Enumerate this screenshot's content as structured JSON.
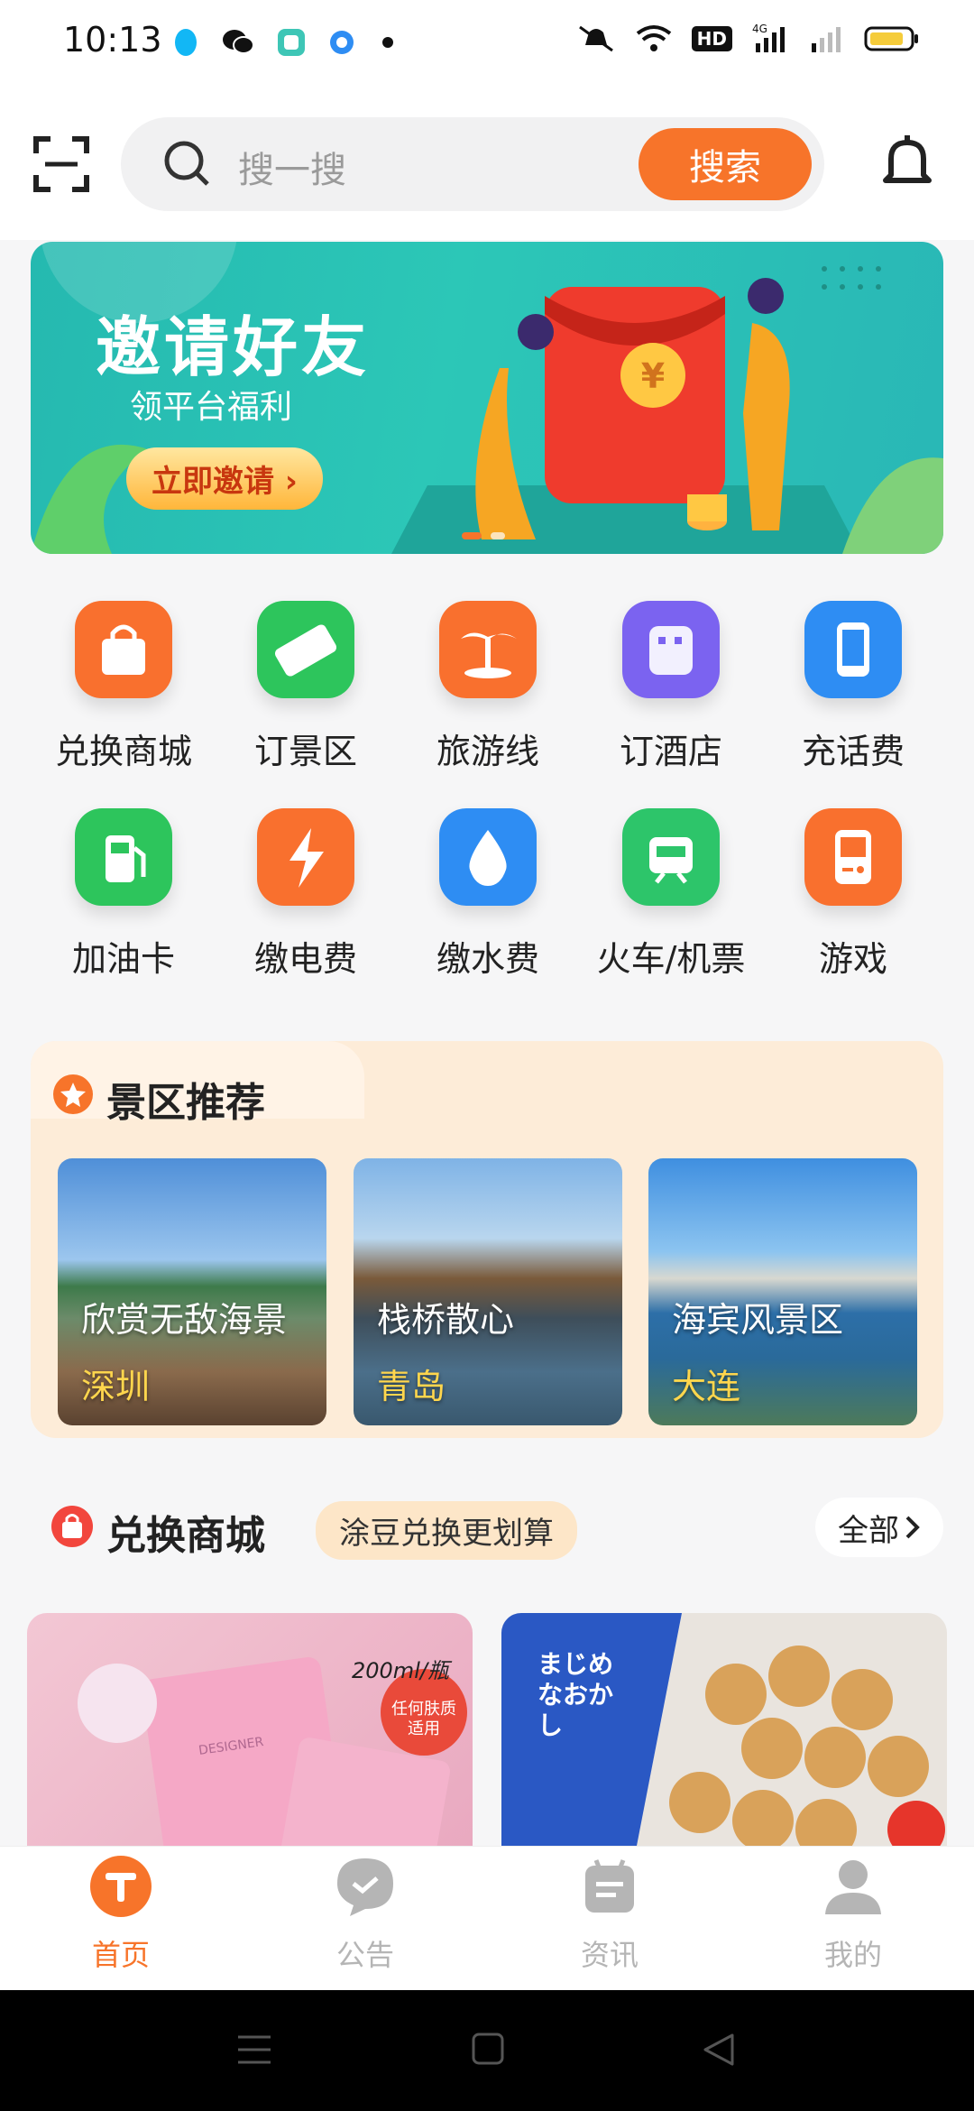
{
  "status": {
    "time": "10:13",
    "network": "4G",
    "hd": "HD"
  },
  "header": {
    "search_placeholder": "搜一搜",
    "search_button": "搜索"
  },
  "banner": {
    "title": "邀请好友",
    "subtitle": "领平台福利",
    "button": "立即邀请 ›",
    "yen": "¥"
  },
  "services": [
    {
      "label": "兑换商城",
      "icon": "shopping-bag-icon",
      "color": "#f9702e"
    },
    {
      "label": "订景区",
      "icon": "ticket-icon",
      "color": "#2dc55c"
    },
    {
      "label": "旅游线",
      "icon": "palm-tree-icon",
      "color": "#f9702e"
    },
    {
      "label": "订酒店",
      "icon": "hotel-icon",
      "color": "#7b63f0"
    },
    {
      "label": "充话费",
      "icon": "phone-icon",
      "color": "#2e8df3"
    },
    {
      "label": "加油卡",
      "icon": "fuel-pump-icon",
      "color": "#2dc55c"
    },
    {
      "label": "缴电费",
      "icon": "lightning-icon",
      "color": "#f9702e"
    },
    {
      "label": "缴水费",
      "icon": "water-drop-icon",
      "color": "#2e8df3"
    },
    {
      "label": "火车/机票",
      "icon": "train-icon",
      "color": "#2dc56a"
    },
    {
      "label": "游戏",
      "icon": "game-console-icon",
      "color": "#f9702e"
    }
  ],
  "scenic": {
    "title": "景区推荐",
    "items": [
      {
        "title": "欣赏无敌海景",
        "city": "深圳"
      },
      {
        "title": "栈桥散心",
        "city": "青岛"
      },
      {
        "title": "海宾风景区",
        "city": "大连"
      }
    ]
  },
  "mall": {
    "title": "兑换商城",
    "tag": "涂豆兑换更划算",
    "all": "全部",
    "products": [
      {
        "text": "200ml/瓶",
        "badge": "任何肤质适用",
        "brand": "DESIGNER"
      },
      {
        "text": "まじめなおかし"
      }
    ]
  },
  "tabbar": [
    {
      "label": "首页",
      "active": true
    },
    {
      "label": "公告",
      "active": false
    },
    {
      "label": "资讯",
      "active": false
    },
    {
      "label": "我的",
      "active": false
    }
  ],
  "colors": {
    "accent": "#f7742a",
    "banner": "#2cc7b7",
    "inactive": "#b5b5b5"
  }
}
